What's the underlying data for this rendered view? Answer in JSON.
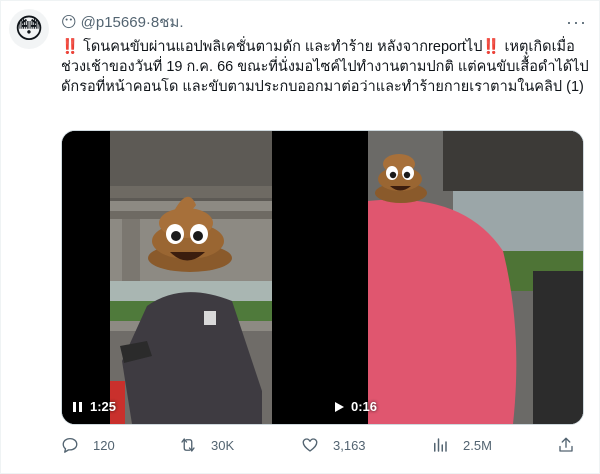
{
  "tweet": {
    "avatar_emoji": "😳",
    "header_emoji": "😶",
    "handle": "@p15669",
    "separator": " · ",
    "time": "8ชม.",
    "more": "···",
    "text": "‼️ โดนคนขับผ่านแอปพลิเคชั่นตามดัก และทำร้าย หลังจากreportไป‼️ เหตุเกิดเมื่อช่วงเช้าของวันที่ 19 ก.ค. 66 ขณะที่นั่งมอไซค์ไปทำงานตามปกติ แต่คนขับเสื้อดำได้ไปดักรอที่หน้าคอนโด และขับตามประกบออกมาต่อว่าและทำร้ายกายเราตามในคลิป (1)"
  },
  "media": [
    {
      "duration": "1:25",
      "control": "pause"
    },
    {
      "duration": "0:16",
      "control": "play"
    }
  ],
  "actions": {
    "replies": "120",
    "reposts": "30K",
    "likes": "3,163",
    "views": "2.5M"
  }
}
